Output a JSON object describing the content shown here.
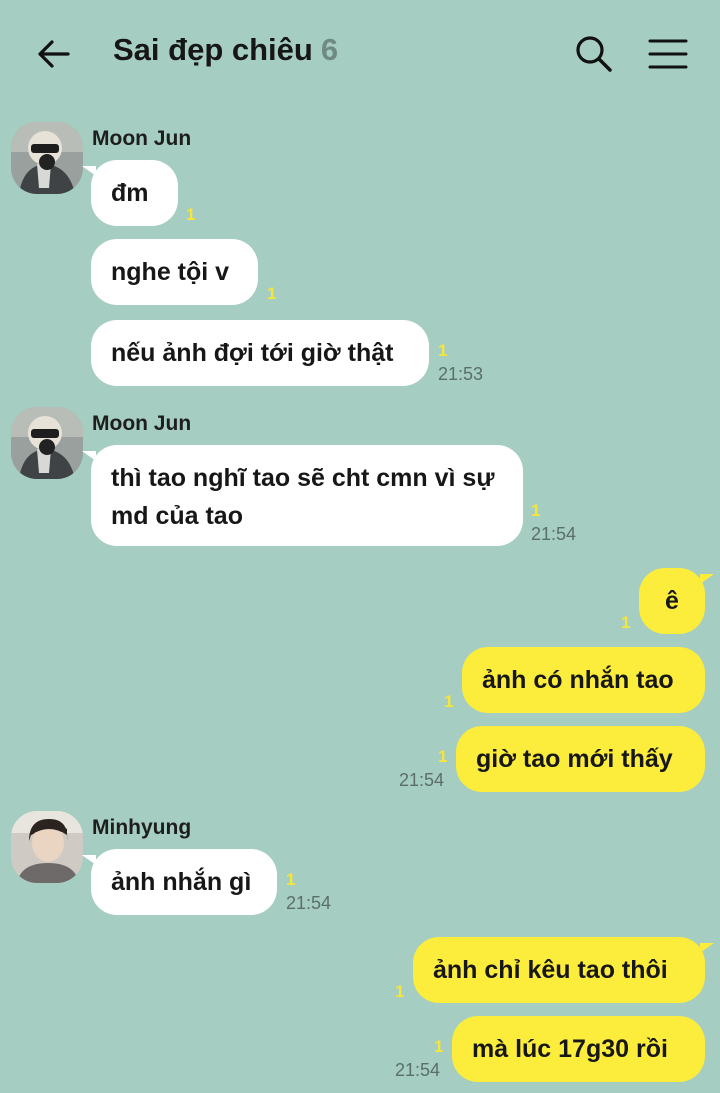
{
  "header": {
    "title": "Sai đẹp chiêu",
    "member_count": "6",
    "icons": [
      "back-arrow-icon",
      "search-icon",
      "menu-icon"
    ]
  },
  "colors": {
    "background": "#a5cdc1",
    "incoming_bubble": "#ffffff",
    "outgoing_bubble": "#fcec3c",
    "unread": "#f6e53a"
  },
  "messages": [
    {
      "sender": "Moon Jun",
      "text": "đm",
      "unread": "1"
    },
    {
      "text": "nghe tội v",
      "unread": "1"
    },
    {
      "text": "nếu ảnh đợi tới giờ thật",
      "unread": "1",
      "time": "21:53"
    },
    {
      "sender": "Moon Jun",
      "text": "thì tao nghĩ tao sẽ cht cmn vì sự md của tao",
      "unread": "1",
      "time": "21:54"
    },
    {
      "text": "ê",
      "unread": "1"
    },
    {
      "text": "ảnh có nhắn tao",
      "unread": "1"
    },
    {
      "text": "giờ tao mới thấy",
      "unread": "1",
      "time": "21:54"
    },
    {
      "sender": "Minhyung",
      "text": "ảnh nhắn gì",
      "unread": "1",
      "time": "21:54"
    },
    {
      "text": "ảnh chỉ kêu tao thôi",
      "unread": "1"
    },
    {
      "text": "mà lúc 17g30 rồi",
      "unread": "1",
      "time": "21:54"
    }
  ]
}
